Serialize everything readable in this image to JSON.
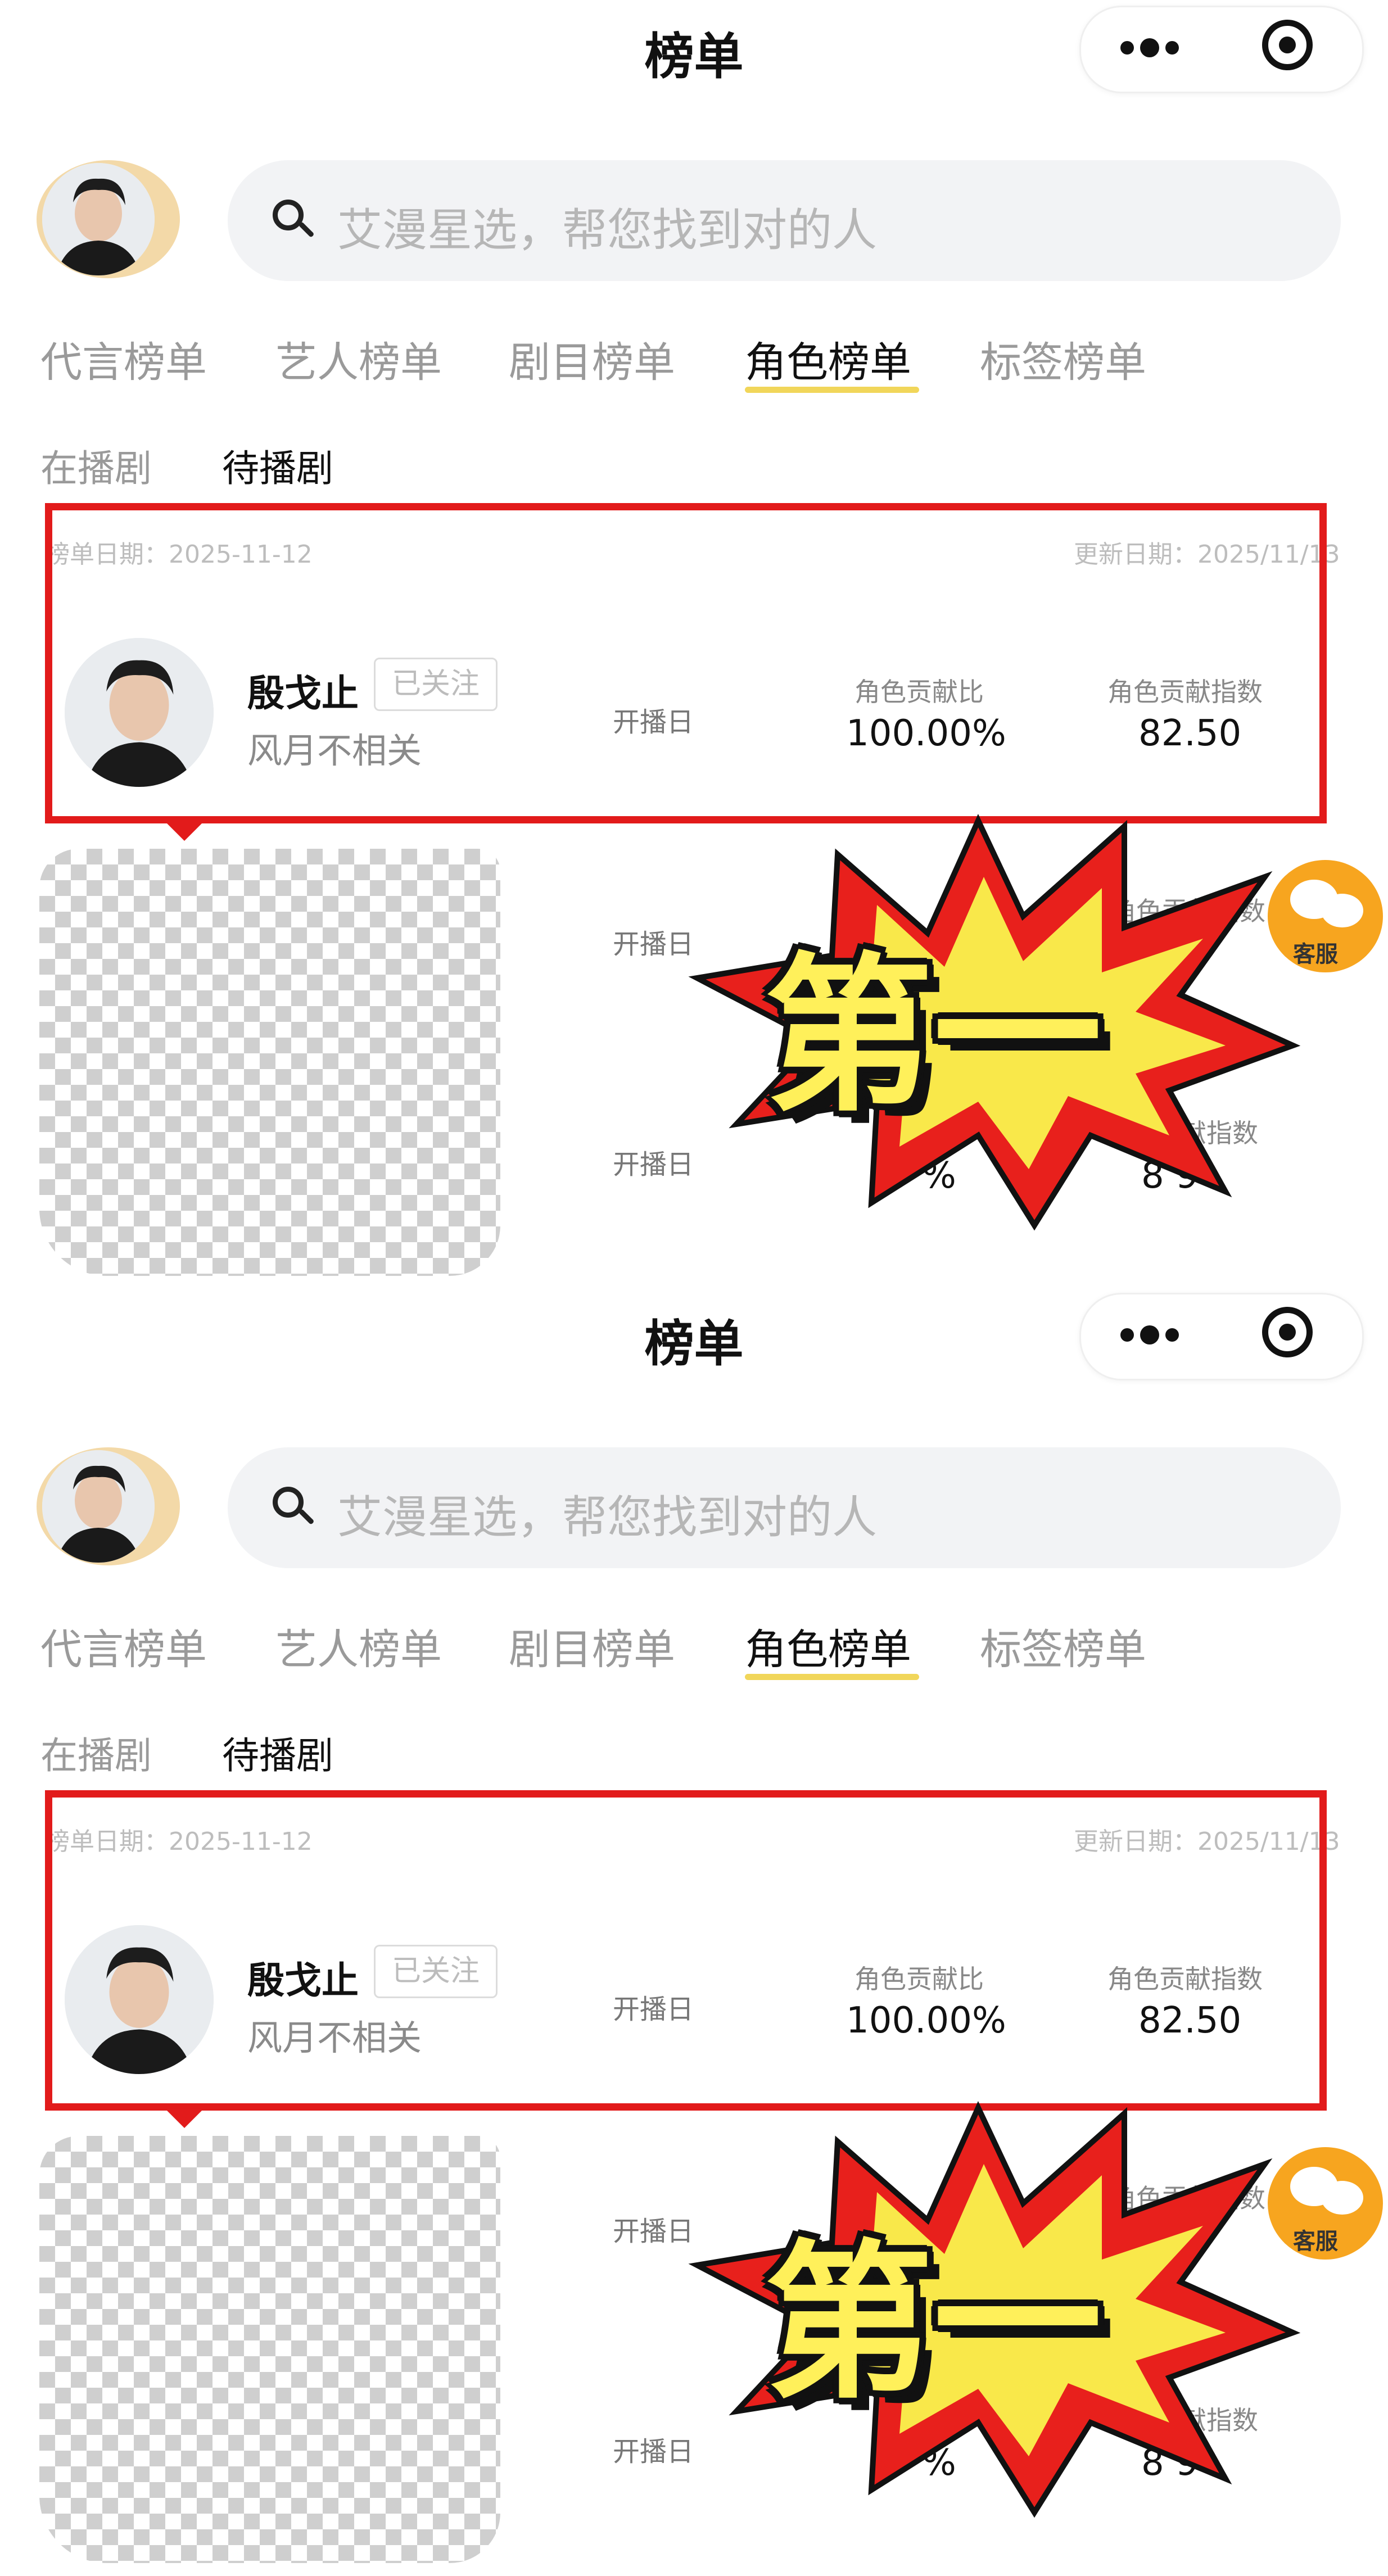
{
  "header": {
    "title": "榜单"
  },
  "search": {
    "placeholder": "艾漫星选，帮您找到对的人"
  },
  "tabs": [
    {
      "label": "代言榜单"
    },
    {
      "label": "艺人榜单"
    },
    {
      "label": "剧目榜单"
    },
    {
      "label": "角色榜单",
      "active": true
    },
    {
      "label": "标签榜单"
    }
  ],
  "subtabs": [
    {
      "label": "在播剧"
    },
    {
      "label": "待播剧",
      "active": true
    }
  ],
  "list": {
    "list_date": "榜单日期：2025-11-12",
    "update_date": "更新日期：2025/11/13",
    "top_row": {
      "name": "殷戈止",
      "follow_label": "已关注",
      "drama": "风月不相关",
      "air_label": "开播日",
      "ratio_label": "角色贡献比",
      "ratio_value": "100.00%",
      "index_label": "角色贡献指数",
      "index_value": "82.50"
    },
    "hidden_rows": [
      {
        "air_label": "开播日",
        "index_label": "角色贡献指数"
      },
      {
        "air_label": "开播日",
        "index_label": "献指数",
        "ratio_value": "%",
        "index_value": "8  9"
      }
    ]
  },
  "sticker": {
    "text": "第一"
  },
  "service": {
    "label": "客服"
  },
  "colors": {
    "highlight_red": "#e21b1b",
    "tab_underline": "#f1d65a",
    "service": "#f7a51f",
    "sticker_yellow": "#fff05a"
  }
}
